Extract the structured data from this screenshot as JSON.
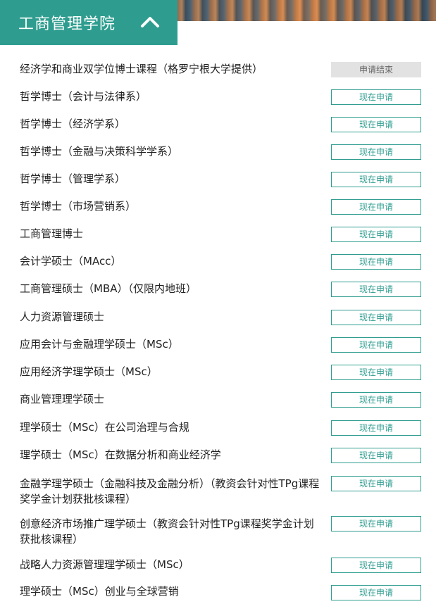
{
  "header": {
    "title": "工商管理学院"
  },
  "programs": [
    {
      "name": "经济学和商业双学位博士课程（格罗宁根大学提供）",
      "status": "申请结束",
      "closed": true
    },
    {
      "name": "哲学博士（会计与法律系）",
      "status": "现在申请",
      "closed": false
    },
    {
      "name": "哲学博士（经济学系）",
      "status": "现在申请",
      "closed": false
    },
    {
      "name": "哲学博士（金融与决策科学学系）",
      "status": "现在申请",
      "closed": false
    },
    {
      "name": "哲学博士（管理学系）",
      "status": "现在申请",
      "closed": false
    },
    {
      "name": "哲学博士（市场营销系）",
      "status": "现在申请",
      "closed": false
    },
    {
      "name": "工商管理博士",
      "status": "现在申请",
      "closed": false
    },
    {
      "name": "会计学硕士（MAcc）",
      "status": "现在申请",
      "closed": false
    },
    {
      "name": "工商管理硕士（MBA）（仅限内地班）",
      "status": "现在申请",
      "closed": false
    },
    {
      "name": "人力资源管理硕士",
      "status": "现在申请",
      "closed": false
    },
    {
      "name": "应用会计与金融理学硕士（MSc）",
      "status": "现在申请",
      "closed": false
    },
    {
      "name": "应用经济学理学硕士（MSc）",
      "status": "现在申请",
      "closed": false
    },
    {
      "name": "商业管理理学硕士",
      "status": "现在申请",
      "closed": false
    },
    {
      "name": "理学硕士（MSc）在公司治理与合规",
      "status": "现在申请",
      "closed": false
    },
    {
      "name": "理学硕士（MSc）在数据分析和商业经济学",
      "status": "现在申请",
      "closed": false
    },
    {
      "name": "金融学理学硕士（金融科技及金融分析）（教资会针对性TPg课程奖学金计划获批核课程）",
      "status": "现在申请",
      "closed": false
    },
    {
      "name": "创意经济市场推广理学硕士（教资会针对性TPg课程奖学金计划获批核课程）",
      "status": "现在申请",
      "closed": false
    },
    {
      "name": "战略人力资源管理理学硕士（MSc）",
      "status": "现在申请",
      "closed": false
    },
    {
      "name": "理学硕士（MSc）创业与全球营销",
      "status": "现在申请",
      "closed": false
    }
  ]
}
